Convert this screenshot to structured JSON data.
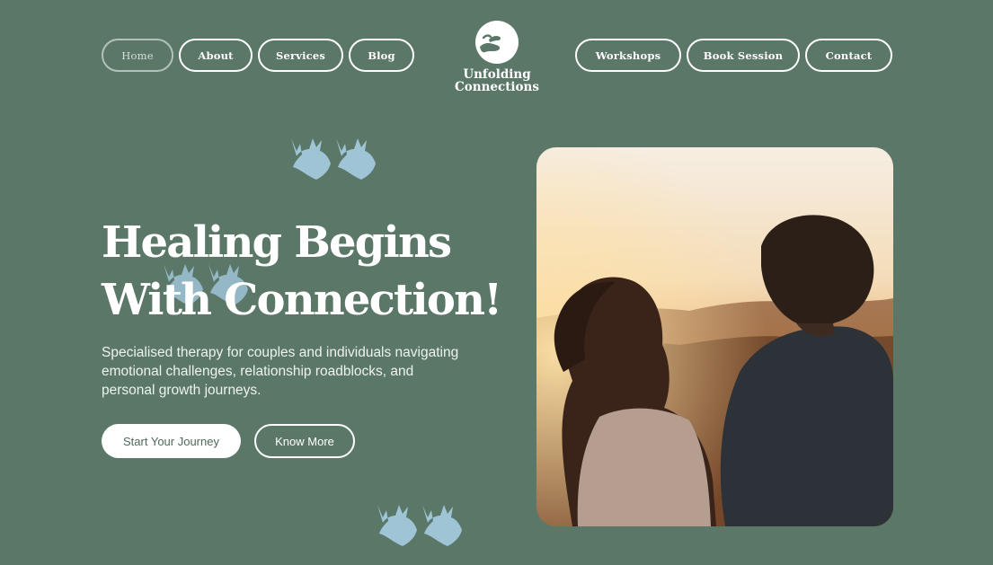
{
  "nav": {
    "left": [
      {
        "label": "Home",
        "active": true
      },
      {
        "label": "About"
      },
      {
        "label": "Services"
      },
      {
        "label": "Blog"
      }
    ],
    "right": [
      {
        "label": "Workshops"
      },
      {
        "label": "Book Session"
      },
      {
        "label": "Contact"
      }
    ]
  },
  "logo": {
    "text": "Unfolding\nConnections",
    "icon": "hands-circle-icon"
  },
  "hero": {
    "headline": "Healing Begins\nWith Connection!",
    "subtext": "Specialised therapy for couples and individuals navigating emotional challenges, relationship roadblocks, and personal growth journeys.",
    "primary_cta": "Start Your Journey",
    "secondary_cta": "Know More",
    "image": "couple-sunset-photo",
    "decor_icon": "birds-icon"
  },
  "colors": {
    "background": "#5a7768",
    "bird": "#9fc4d6",
    "text": "#ffffff"
  }
}
